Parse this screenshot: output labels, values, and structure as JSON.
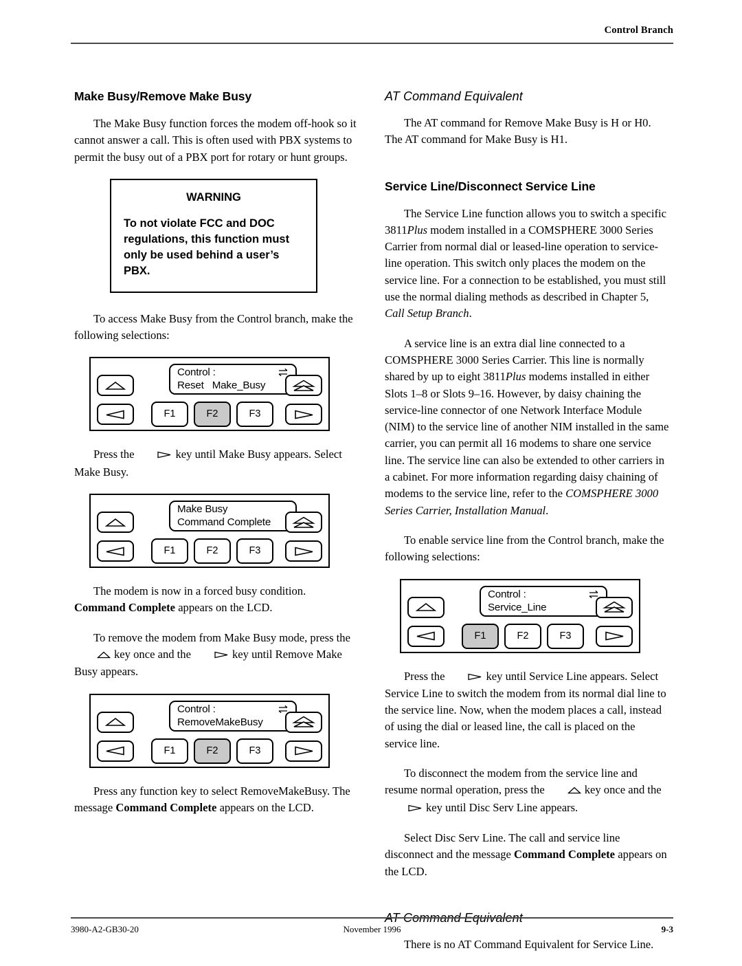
{
  "header": {
    "running_head": "Control Branch"
  },
  "footer": {
    "doc_number": "3980-A2-GB30-20",
    "date": "November 1996",
    "page_number": "9-3"
  },
  "left_column": {
    "heading": "Make Busy/Remove Make Busy",
    "intro_paragraph": "The Make Busy function forces the modem off-hook so it cannot answer a call. This is often used with PBX systems to permit the busy out of a PBX port for rotary or hunt groups.",
    "warning": {
      "title": "WARNING",
      "text": "To not violate FCC and DOC regulations, this function must only be used behind a user’s PBX."
    },
    "access_paragraph": "To access Make Busy from the Control branch, make the following selections:",
    "panel1": {
      "lcd_line1": "Control :",
      "lcd_line2": "Reset   Make_Busy",
      "transfer_icon": "transfer-icon",
      "fkeys": [
        "F1",
        "F2",
        "F3"
      ],
      "selected_fkey": "F2"
    },
    "press_paragraph_pre": "Press the",
    "press_paragraph_post": "key until Make Busy appears. Select Make Busy.",
    "panel2": {
      "lcd_line1": "Make Busy",
      "lcd_line2": "Command Complete",
      "transfer_icon": "",
      "fkeys": [
        "F1",
        "F2",
        "F3"
      ],
      "selected_fkey": ""
    },
    "forced_busy_pre": "The modem is now in a forced busy condition.",
    "forced_busy_bold": "Command Complete",
    "forced_busy_post": "appears on the LCD.",
    "remove_pre": "To remove the modem from Make Busy mode, press the",
    "remove_mid": "key once and the",
    "remove_post": "key until Remove Make Busy appears.",
    "panel3": {
      "lcd_line1": "Control :",
      "lcd_line2": "RemoveMakeBusy",
      "transfer_icon": "transfer-icon",
      "fkeys": [
        "F1",
        "F2",
        "F3"
      ],
      "selected_fkey": "F2"
    },
    "final_pre": "Press any function key to select RemoveMakeBusy. The message",
    "final_bold": "Command Complete",
    "final_post": "appears on the LCD."
  },
  "right_column": {
    "at_heading_1": "AT Command Equivalent",
    "at_paragraph_1": "The AT command for Remove Make Busy is H or H0. The AT command for Make Busy is H1.",
    "service_heading": "Service Line/Disconnect Service Line",
    "service_para_1_a": "The Service Line function allows you to switch a specific 3811",
    "service_para_1_italic1": "Plus",
    "service_para_1_b": " modem installed in a COMSPHERE 3000 Series Carrier from normal dial or leased-line operation to service-line operation. This switch only places the modem on the service line. For a connection to be established, you must still use the normal dialing methods as described in Chapter 5, ",
    "service_para_1_italic2": "Call Setup Branch",
    "service_para_1_c": ".",
    "service_para_2_a": "A service line is an extra dial line connected to a COMSPHERE 3000 Series Carrier. This line is normally shared by up to eight 3811",
    "service_para_2_italic1": "Plus",
    "service_para_2_b": " modems installed in either Slots 1–8 or Slots 9–16. However, by daisy chaining the service-line connector of one Network Interface Module (NIM) to the service line of another NIM installed in the same carrier, you can permit all 16 modems to share one service line. The service line can also be extended to other carriers in a cabinet. For more information regarding daisy chaining of modems to the service line, refer to the ",
    "service_para_2_italic2": "COMSPHERE 3000 Series Carrier, Installation Manual",
    "service_para_2_c": ".",
    "enable_paragraph": "To enable service line from the Control branch, make the following selections:",
    "panel4": {
      "lcd_line1": "Control :",
      "lcd_line2": "Service_Line",
      "transfer_icon": "transfer-icon",
      "fkeys": [
        "F1",
        "F2",
        "F3"
      ],
      "selected_fkey": "F1"
    },
    "press_pre": "Press the",
    "press_post": "key until Service Line appears. Select Service Line to switch the modem from its normal dial line to the service line. Now, when the modem places a call, instead of using the dial or leased line, the call is placed on the service line.",
    "disc_pre": "To disconnect the modem from the service line and resume normal operation, press the",
    "disc_mid": "key once and the",
    "disc_post": "key until Disc Serv Line appears.",
    "select_pre": "Select Disc Serv Line. The call and service line disconnect and the message",
    "select_bold": "Command Complete",
    "select_post": "appears on the LCD.",
    "at_heading_2": "AT Command Equivalent",
    "at_paragraph_2": "There is no AT Command Equivalent for Service Line."
  },
  "colors": {
    "rule": "#4a4a4a",
    "selected_key": "#c9c9c9",
    "ink": "#000000"
  }
}
